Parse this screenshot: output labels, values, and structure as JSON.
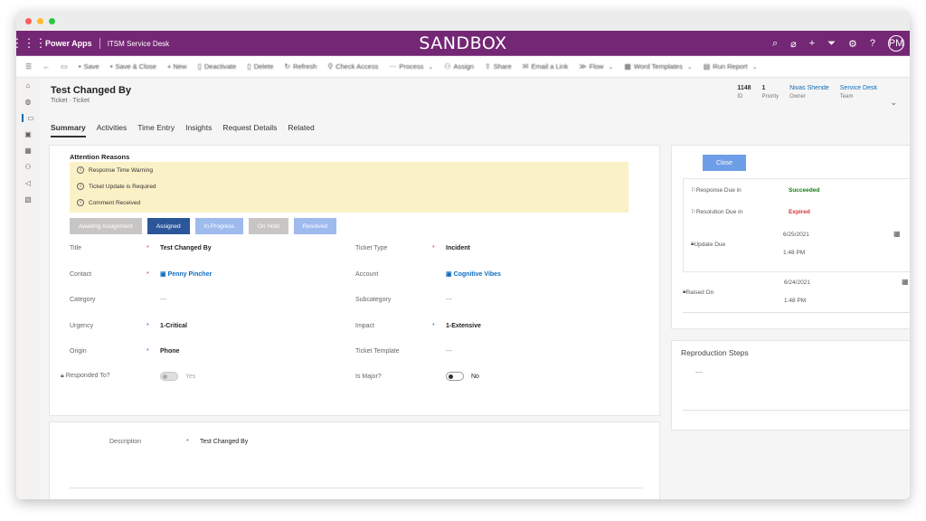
{
  "appbar": {
    "brand": "Power Apps",
    "app_name": "ITSM Service Desk",
    "environment_banner": "SANDBOX",
    "avatar_initials": "PM",
    "color": "#742774"
  },
  "commandbar": {
    "save": "Save",
    "save_close": "Save & Close",
    "new": "+ New",
    "deactivate": "Deactivate",
    "delete": "Delete",
    "refresh": "Refresh",
    "check_access": "Check Access",
    "process": "Process",
    "assign": "Assign",
    "share": "Share",
    "email_link": "Email a Link",
    "flow": "Flow",
    "word_templates": "Word Templates",
    "run_report": "Run Report"
  },
  "record": {
    "title": "Test Changed By",
    "subtitle": "Ticket · Ticket",
    "header_fields": [
      {
        "value": "1148",
        "label": "ID"
      },
      {
        "value": "1",
        "label": "Priority"
      },
      {
        "value": "Nivas Shende",
        "label": "Owner"
      },
      {
        "value": "Service Desk",
        "label": "Team"
      }
    ]
  },
  "tabs": [
    "Summary",
    "Activities",
    "Time Entry",
    "Insights",
    "Request Details",
    "Related"
  ],
  "attention": {
    "title": "Attention Reasons",
    "items": [
      "Response Time Warning",
      "Ticket Update is Required",
      "Comment Received"
    ]
  },
  "stages": [
    "Awaiting Assignment",
    "Assigned",
    "In Progress",
    "On Hold",
    "Resolved"
  ],
  "fields": {
    "title": {
      "label": "Title",
      "value": "Test Changed By"
    },
    "ticket_type": {
      "label": "Ticket Type",
      "value": "Incident"
    },
    "contact": {
      "label": "Contact",
      "value": "Penny Pincher"
    },
    "account": {
      "label": "Account",
      "value": "Cognitive Vibes"
    },
    "category": {
      "label": "Category",
      "value": "---"
    },
    "subcategory": {
      "label": "Subcategory",
      "value": "---"
    },
    "urgency": {
      "label": "Urgency",
      "value": "1-Critical"
    },
    "impact": {
      "label": "Impact",
      "value": "1-Extensive"
    },
    "origin": {
      "label": "Origin",
      "value": "Phone"
    },
    "ticket_template": {
      "label": "Ticket Template",
      "value": "---"
    },
    "responded_to": {
      "label": "Responded To?",
      "value": "Yes"
    },
    "is_major": {
      "label": "Is Major?",
      "value": "No"
    },
    "description": {
      "label": "Description",
      "value": "Test Changed By"
    }
  },
  "side": {
    "close_button": "Close",
    "response_due": {
      "label": "Response Due in",
      "status": "Succeeded"
    },
    "resolution_due": {
      "label": "Resolution Due in",
      "status": "Expired"
    },
    "update_due": {
      "label": "Update Due",
      "date": "6/25/2021",
      "time": "1:48 PM"
    },
    "raised_on": {
      "label": "Raised On",
      "date": "6/24/2021",
      "time": "1:48 PM"
    },
    "repro_title": "Reproduction Steps",
    "repro_value": "---"
  }
}
